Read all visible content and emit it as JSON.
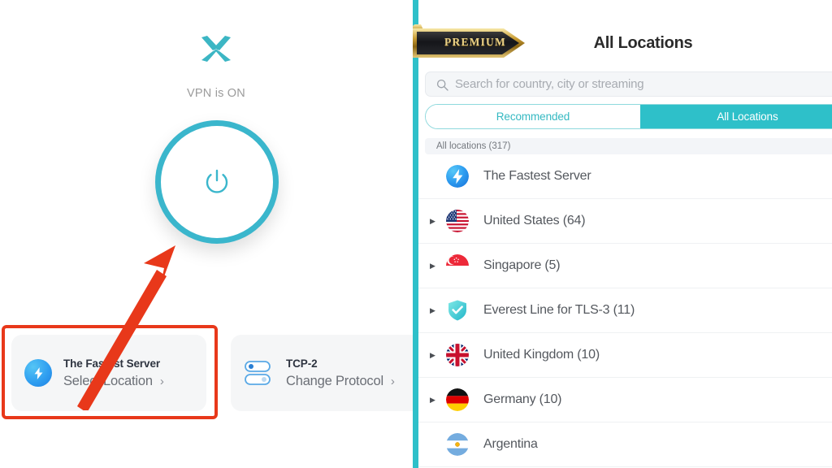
{
  "left": {
    "brand_logo_icon": "x-logo-icon",
    "vpn_status_text": "VPN is ON",
    "power_button_icon": "power-icon",
    "cards": {
      "location": {
        "icon": "fastest-server-bolt-icon",
        "title": "The Fastest Server",
        "subtitle": "Select Location",
        "chevron": "›"
      },
      "protocol": {
        "icon": "protocol-toggles-icon",
        "title": "TCP-2",
        "subtitle": "Change Protocol",
        "chevron": "›"
      }
    },
    "annotation": {
      "box_color": "#e8381a",
      "arrow_color": "#e8381a"
    }
  },
  "divider": {
    "color": "#2ec0c9"
  },
  "right": {
    "premium_badge": "PREMIUM",
    "title": "All Locations",
    "search": {
      "icon": "search-icon",
      "placeholder": "Search for country, city or streaming",
      "value": ""
    },
    "tabs": [
      {
        "label": "Recommended",
        "active": false
      },
      {
        "label": "All Locations",
        "active": true
      }
    ],
    "list_header": "All locations (317)",
    "locations": [
      {
        "name": "The Fastest Server",
        "icon": "fastest-server-bolt-icon",
        "expandable": false
      },
      {
        "name": "United States (64)",
        "icon": "flag-us-icon",
        "expandable": true
      },
      {
        "name": "Singapore (5)",
        "icon": "flag-sg-icon",
        "expandable": true
      },
      {
        "name": "Everest Line for TLS-3 (11)",
        "icon": "shield-check-icon",
        "expandable": true
      },
      {
        "name": "United Kingdom (10)",
        "icon": "flag-uk-icon",
        "expandable": true
      },
      {
        "name": "Germany (10)",
        "icon": "flag-de-icon",
        "expandable": true
      },
      {
        "name": "Argentina",
        "icon": "flag-ar-icon",
        "expandable": false
      }
    ]
  },
  "colors": {
    "accent_teal": "#2ec0c9",
    "power_ring": "#3ab6cc",
    "annotation_red": "#e8381a",
    "premium_gold": "#e8cf86"
  }
}
